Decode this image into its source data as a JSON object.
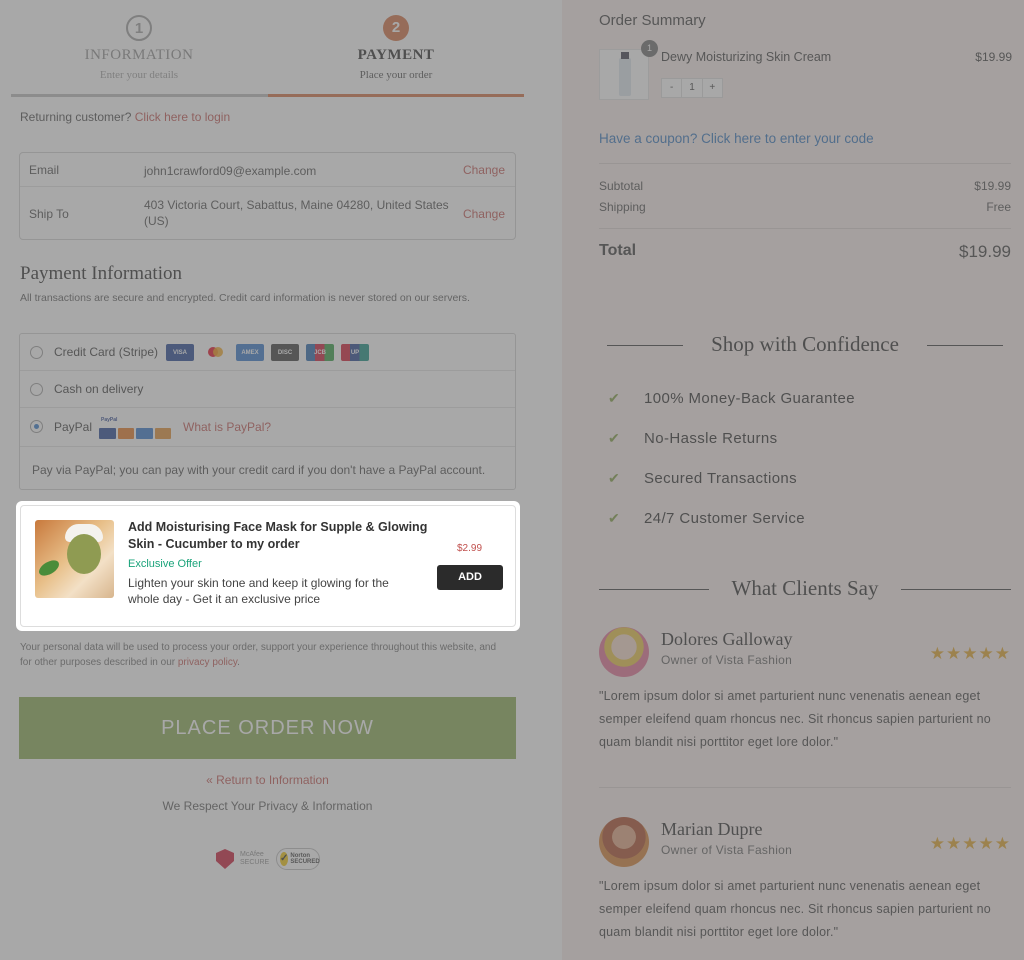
{
  "steps": [
    {
      "number": "1",
      "title": "INFORMATION",
      "subtitle": "Enter your details"
    },
    {
      "number": "2",
      "title": "PAYMENT",
      "subtitle": "Place your order"
    }
  ],
  "returning": {
    "text": "Returning customer?",
    "link": "Click here to login"
  },
  "contact": {
    "email_label": "Email",
    "email_value": "john1crawford09@example.com",
    "email_change": "Change",
    "ship_label": "Ship To",
    "ship_value": "403 Victoria Court, Sabattus, Maine 04280, United States (US)",
    "ship_change": "Change"
  },
  "payment": {
    "title": "Payment Information",
    "description": "All transactions are secure and encrypted. Credit card information is never stored on our servers.",
    "options": [
      {
        "label": "Credit Card (Stripe)",
        "selected": false
      },
      {
        "label": "Cash on delivery",
        "selected": false
      },
      {
        "label": "PayPal",
        "selected": true
      }
    ],
    "card_icons": [
      "visa-icon",
      "mastercard-icon",
      "amex-icon",
      "discover-icon",
      "jcb-icon",
      "unionpay-icon"
    ],
    "paypal_link": "What is PayPal?",
    "paypal_note": "Pay via PayPal; you can pay with your credit card if you don't have a PayPal account."
  },
  "offer": {
    "title": "Add Moisturising Face Mask for Supple & Glowing Skin - Cucumber to my order",
    "tag": "Exclusive Offer",
    "description": "Lighten your skin tone and keep it glowing for the whole day - Get it an exclusive price",
    "price": "$2.99",
    "button": "ADD"
  },
  "personal_data": {
    "text": "Your personal data will be used to process your order, support your experience throughout this website, and for other purposes described in our",
    "link": "privacy policy",
    "end": "."
  },
  "place_order": "PLACE ORDER NOW",
  "return_link": "« Return to Information",
  "privacy_note": "We Respect Your Privacy & Information",
  "badges": {
    "mcafee": "McAfee SECURE",
    "norton": "Norton SECURED"
  },
  "summary": {
    "title": "Order Summary",
    "item": {
      "name": "Dewy Moisturizing Skin Cream",
      "price": "$19.99",
      "qty": "1",
      "minus": "-",
      "plus": "+",
      "badge": "1"
    },
    "coupon": "Have a coupon? Click here to enter your code",
    "subtotal_label": "Subtotal",
    "subtotal_value": "$19.99",
    "shipping_label": "Shipping",
    "shipping_value": "Free",
    "total_label": "Total",
    "total_value": "$19.99"
  },
  "confidence": {
    "title": "Shop with Confidence",
    "items": [
      "100% Money-Back Guarantee",
      "No-Hassle Returns",
      "Secured Transactions",
      "24/7 Customer Service"
    ]
  },
  "clients": {
    "title": "What Clients Say",
    "reviews": [
      {
        "name": "Dolores Galloway",
        "role": "Owner of Vista Fashion",
        "stars": "★★★★★",
        "rating": 5,
        "text": "\"Lorem ipsum dolor si amet parturient nunc venenatis aenean eget semper eleifend quam rhoncus nec. Sit rhoncus sapien parturient no quam blandit nisi porttitor eget lore dolor.\""
      },
      {
        "name": "Marian Dupre",
        "role": "Owner of Vista Fashion",
        "stars": "★★★★★",
        "rating": 5,
        "text": "\"Lorem ipsum dolor si amet parturient nunc venenatis aenean eget semper eleifend quam rhoncus nec. Sit rhoncus sapien parturient no quam blandit nisi porttitor eget lore dolor.\""
      }
    ]
  },
  "colors": {
    "accent": "#d16a3a",
    "button": "#84a84d",
    "link": "#c0504d",
    "coupon": "#2a6fb8",
    "right_bg": "#f8ece9"
  }
}
